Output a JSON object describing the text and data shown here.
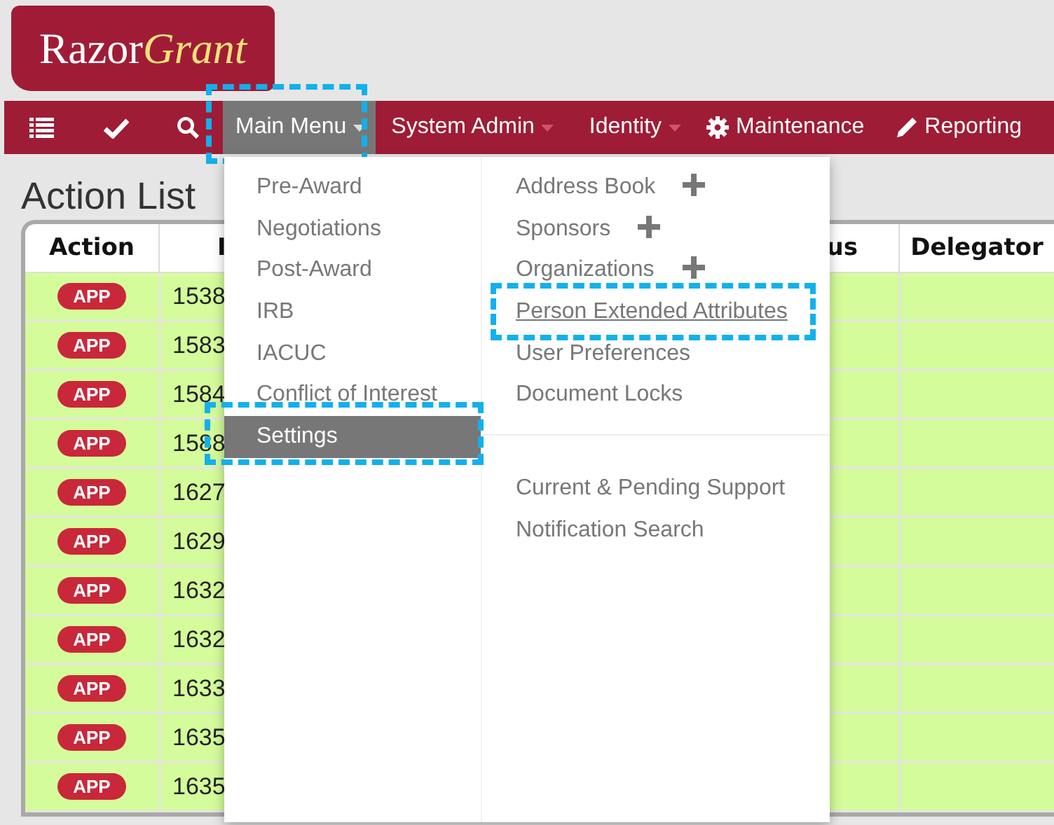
{
  "logo": {
    "name": "Razor",
    "accent": "Grant"
  },
  "nav": [
    {
      "kind": "tool"
    },
    {
      "kind": "tool"
    },
    {
      "kind": "tool"
    },
    {
      "kind": "menu",
      "label": "Main Menu",
      "selected": true,
      "highlighted": true
    },
    {
      "kind": "menu",
      "label": "System Admin",
      "selected": false,
      "highlighted": false
    },
    {
      "kind": "menu",
      "label": "Identity",
      "selected": false,
      "highlighted": false
    },
    {
      "kind": "link",
      "label": "Maintenance"
    },
    {
      "kind": "link",
      "label": "Reporting"
    }
  ],
  "page": {
    "title": "Action List"
  },
  "table": {
    "columns": [
      "Action",
      "I",
      "us",
      "Delegator"
    ],
    "rows": [
      {
        "action": "APP",
        "id": "1538"
      },
      {
        "action": "APP",
        "id": "1583"
      },
      {
        "action": "APP",
        "id": "1584"
      },
      {
        "action": "APP",
        "id": "1588"
      },
      {
        "action": "APP",
        "id": "1627"
      },
      {
        "action": "APP",
        "id": "1629"
      },
      {
        "action": "APP",
        "id": "1632"
      },
      {
        "action": "APP",
        "id": "1632"
      },
      {
        "action": "APP",
        "id": "1633"
      },
      {
        "action": "APP",
        "id": "1635"
      },
      {
        "action": "APP",
        "id": "1635"
      }
    ]
  },
  "dropdown": {
    "left": [
      {
        "label": "Pre-Award",
        "selected": false,
        "highlighted": false
      },
      {
        "label": "Negotiations",
        "selected": false,
        "highlighted": false
      },
      {
        "label": "Post-Award",
        "selected": false,
        "highlighted": false
      },
      {
        "label": "IRB",
        "selected": false,
        "highlighted": false
      },
      {
        "label": "IACUC",
        "selected": false,
        "highlighted": false
      },
      {
        "label": "Conflict of Interest",
        "selected": false,
        "highlighted": false
      },
      {
        "label": "Settings",
        "selected": true,
        "highlighted": true
      }
    ],
    "right": [
      {
        "label": "Address Book",
        "addable": true,
        "hovered": false,
        "highlighted": false
      },
      {
        "label": "Sponsors",
        "addable": true,
        "hovered": false,
        "highlighted": false
      },
      {
        "label": "Organizations",
        "addable": true,
        "hovered": false,
        "highlighted": false
      },
      {
        "label": "Person Extended Attributes",
        "addable": false,
        "hovered": true,
        "highlighted": true
      },
      {
        "label": "User Preferences",
        "addable": false,
        "hovered": false,
        "highlighted": false
      },
      {
        "label": "Document Locks",
        "addable": false,
        "hovered": false,
        "highlighted": false
      }
    ],
    "right_lower": [
      {
        "label": "Current & Pending Support",
        "addable": false,
        "hovered": false,
        "highlighted": false
      },
      {
        "label": "Notification Search",
        "addable": false,
        "hovered": false,
        "highlighted": false
      }
    ]
  }
}
